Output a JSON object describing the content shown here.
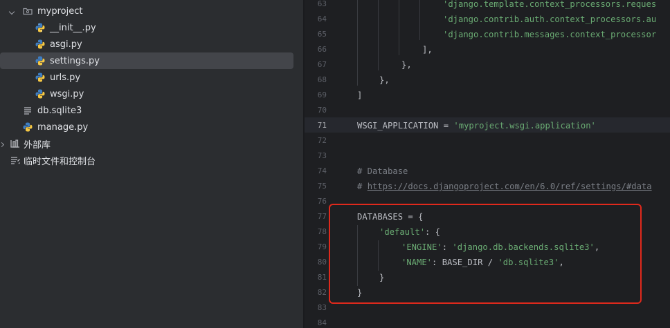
{
  "tree": {
    "items": [
      {
        "label": "myproject",
        "type": "folder"
      },
      {
        "label": "__init__.py",
        "type": "python"
      },
      {
        "label": "asgi.py",
        "type": "python"
      },
      {
        "label": "settings.py",
        "type": "python"
      },
      {
        "label": "urls.py",
        "type": "python"
      },
      {
        "label": "wsgi.py",
        "type": "python"
      },
      {
        "label": "db.sqlite3",
        "type": "db"
      },
      {
        "label": "manage.py",
        "type": "python"
      },
      {
        "label": "外部库",
        "type": "library"
      },
      {
        "label": "临时文件和控制台",
        "type": "scratch"
      }
    ]
  },
  "editor": {
    "line_numbers": [
      "63",
      "64",
      "65",
      "66",
      "67",
      "68",
      "69",
      "70",
      "71",
      "72",
      "73",
      "74",
      "75",
      "76",
      "77",
      "78",
      "79",
      "80",
      "81",
      "82",
      "83",
      "84"
    ],
    "current_line": "71",
    "lines": {
      "l63": "'django.template.context_processors.reques",
      "l64": "'django.contrib.auth.context_processors.au",
      "l65": "'django.contrib.messages.context_processor",
      "l66": "],",
      "l67": "},",
      "l68": "},",
      "l69": "]",
      "l71a": "WSGI_APPLICATION = ",
      "l71b": "'myproject.wsgi.application'",
      "l74": "# Database",
      "l75a": "# ",
      "l75b": "https://docs.djangoproject.com/en/6.0/ref/settings/#data",
      "l77": "DATABASES = {",
      "l78a": "'default'",
      "l78b": ": {",
      "l79a": "'ENGINE'",
      "l79b": ": ",
      "l79c": "'django.db.backends.sqlite3'",
      "l79d": ",",
      "l80a": "'NAME'",
      "l80b": ": BASE_DIR / ",
      "l80c": "'db.sqlite3'",
      "l80d": ",",
      "l81": "}",
      "l82": "}"
    }
  },
  "colors": {
    "highlight_box": "#e0291c",
    "string": "#6aab73",
    "comment": "#7a7e85"
  }
}
